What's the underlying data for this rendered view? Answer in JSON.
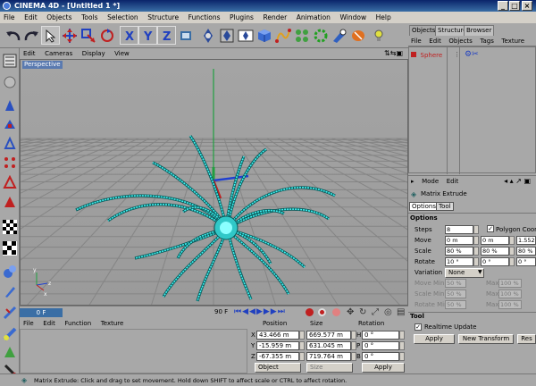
{
  "app": {
    "title": "CINEMA 4D - [Untitled 1 *]"
  },
  "menu": [
    "File",
    "Edit",
    "Objects",
    "Tools",
    "Selection",
    "Structure",
    "Functions",
    "Plugins",
    "Render",
    "Animation",
    "Window",
    "Help"
  ],
  "toolbar_icons": [
    "undo-icon",
    "redo-icon",
    "live-selection-icon",
    "move-icon",
    "scale-icon",
    "rotate-icon",
    "x-axis-icon",
    "y-axis-icon",
    "z-axis-icon",
    "coordinate-system-icon",
    "render-view-icon",
    "render-region-icon",
    "render-picture-viewer-icon",
    "cube-icon",
    "nurbs-icon",
    "array-icon",
    "deformer-icon",
    "scene-icon",
    "camera-icon",
    "light-icon"
  ],
  "viewport": {
    "menu": [
      "Edit",
      "Cameras",
      "Display",
      "View"
    ],
    "label": "Perspective"
  },
  "timeline": {
    "start": "0 F",
    "end": "90 F"
  },
  "materials": {
    "menu": [
      "File",
      "Edit",
      "Function",
      "Texture"
    ]
  },
  "coordinates": {
    "headers": {
      "position": "Position",
      "size": "Size",
      "rotation": "Rotation"
    },
    "rows": [
      {
        "axis": "X",
        "pos": "43.466 m",
        "size": "669.577 m",
        "rot_axis": "H",
        "rot": "0 °"
      },
      {
        "axis": "Y",
        "pos": "-15.959 m",
        "size": "631.045 m",
        "rot_axis": "P",
        "rot": "0 °"
      },
      {
        "axis": "Z",
        "pos": "-67.355 m",
        "size": "719.764 m",
        "rot_axis": "B",
        "rot": "0 °"
      }
    ],
    "mode_select": "Object",
    "size_select": "Size",
    "apply": "Apply"
  },
  "right_tabs": [
    "Objects",
    "Structure",
    "Browser"
  ],
  "objects": {
    "menu": [
      "File",
      "Edit",
      "Objects",
      "Tags",
      "Texture"
    ],
    "items": [
      {
        "name": "Sphere"
      }
    ]
  },
  "attributes": {
    "header": [
      "Mode",
      "Edit"
    ],
    "title": "Matrix Extrude",
    "tabs": [
      "Options",
      "Tool"
    ],
    "options_label": "Options",
    "steps_label": "Steps",
    "steps": "8",
    "polygon_coords_label": "Polygon Coordi",
    "move_label": "Move",
    "move": [
      "0 m",
      "0 m",
      "1.552"
    ],
    "scale_label": "Scale",
    "scale": [
      "80 %",
      "80 %",
      "80 %"
    ],
    "rotate_label": "Rotate",
    "rotate": [
      "10 °",
      "0 °",
      "0 °"
    ],
    "variation_label": "Variation",
    "variation": "None",
    "move_min_label": "Move Min.",
    "move_min": "50 %",
    "move_max_label": "Max.",
    "move_max": "100 %",
    "scale_min_label": "Scale Min.",
    "scale_min": "50 %",
    "scale_max_label": "Max.",
    "scale_max": "100 %",
    "rotate_min_label": "Rotate Min.",
    "rotate_min": "50 %",
    "rotate_max_label": "Max.",
    "rotate_max": "100 %",
    "tool_label": "Tool",
    "realtime_label": "Realtime Update",
    "realtime_checked": true,
    "buttons": [
      "Apply",
      "New Transform",
      "Res"
    ]
  },
  "status": "Matrix Extrude: Click and drag to set movement. Hold down SHIFT to affect scale or CTRL to affect rotation."
}
